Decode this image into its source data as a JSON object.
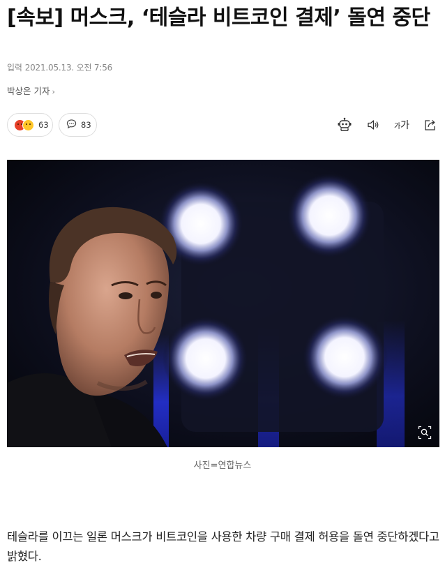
{
  "article": {
    "headline": "[속보] 머스크, ‘테슬라 비트코인 결제’ 돌연 중단",
    "input_label": "입력",
    "datetime": "2021.05.13. 오전 7:56",
    "author": "박상은 기자",
    "author_chevron": "›"
  },
  "reactions": {
    "count": "63",
    "emojis": [
      "angry-emoji",
      "laugh-emoji"
    ]
  },
  "comments": {
    "count": "83"
  },
  "toolbar": {
    "icons": [
      "robot-icon",
      "speaker-icon",
      "font-size-icon",
      "share-icon"
    ],
    "font_small": "가",
    "font_large": "가"
  },
  "photo": {
    "caption": "사진=연합뉴스"
  },
  "body": {
    "paragraph": "테슬라를 이끄는 일론 머스크가 비트코인을 사용한 차량 구매 결제 허용을 돌연 중단하겠다고 밝혔다."
  }
}
